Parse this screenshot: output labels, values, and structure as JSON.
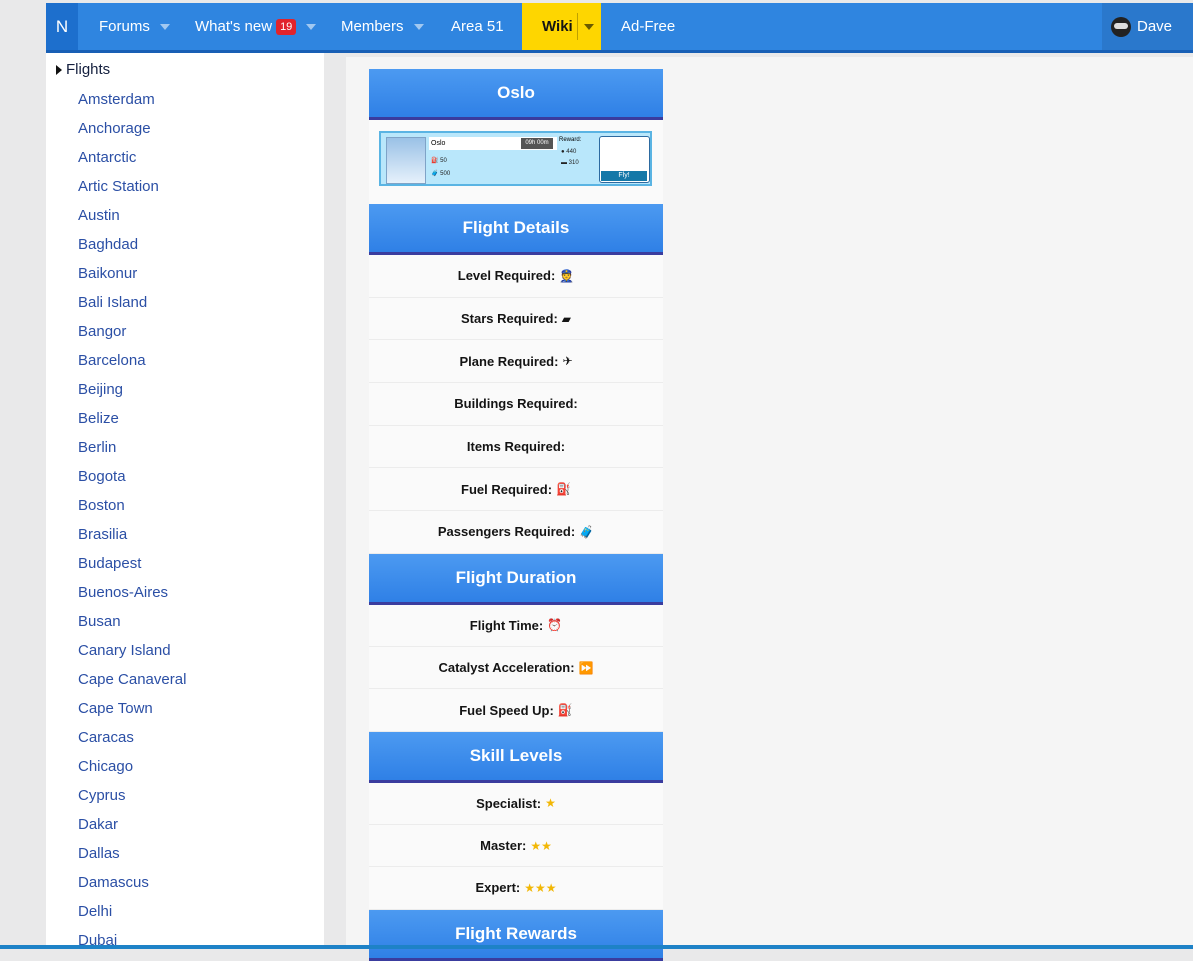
{
  "nav": {
    "logo": "N",
    "forums": "Forums",
    "whats_new": "What's new",
    "whats_new_badge": "19",
    "members": "Members",
    "area51": "Area 51",
    "wiki": "Wiki",
    "adfree": "Ad-Free",
    "user": "Dave"
  },
  "sidebar": {
    "section": "Flights",
    "items": [
      "Amsterdam",
      "Anchorage",
      "Antarctic",
      "Artic Station",
      "Austin",
      "Baghdad",
      "Baikonur",
      "Bali Island",
      "Bangor",
      "Barcelona",
      "Beijing",
      "Belize",
      "Berlin",
      "Bogota",
      "Boston",
      "Brasilia",
      "Budapest",
      "Buenos-Aires",
      "Busan",
      "Canary Island",
      "Cape Canaveral",
      "Cape Town",
      "Caracas",
      "Chicago",
      "Cyprus",
      "Dakar",
      "Dallas",
      "Damascus",
      "Delhi",
      "Dubai"
    ]
  },
  "infobox": {
    "title": "Oslo",
    "card": {
      "city": "Oslo",
      "time": "09h 00m",
      "fuel": "50",
      "passengers": "500",
      "reward_label": "Reward:",
      "reward_coins": "440",
      "reward_xp": "310",
      "fly": "Fly!"
    },
    "details_header": "Flight Details",
    "details": [
      {
        "label": "Level Required:",
        "icon": "👮"
      },
      {
        "label": "Stars Required:",
        "icon": "▰"
      },
      {
        "label": "Plane Required:",
        "icon": "✈"
      },
      {
        "label": "Buildings Required:",
        "icon": ""
      },
      {
        "label": "Items Required:",
        "icon": ""
      },
      {
        "label": "Fuel Required:",
        "icon": "⛽"
      },
      {
        "label": "Passengers Required:",
        "icon": "🧳"
      }
    ],
    "duration_header": "Flight Duration",
    "duration": [
      {
        "label": "Flight Time:",
        "icon": "⏰"
      },
      {
        "label": "Catalyst Acceleration:",
        "icon": "⏩"
      },
      {
        "label": "Fuel Speed Up:",
        "icon": "⛽"
      }
    ],
    "skills_header": "Skill Levels",
    "skills": [
      {
        "label": "Specialist:",
        "icon": "★"
      },
      {
        "label": "Master:",
        "icon": "★★"
      },
      {
        "label": "Expert:",
        "icon": "★★★"
      }
    ],
    "rewards_header": "Flight Rewards"
  },
  "colors": {
    "nav": "#2f85e0",
    "wiki_tab": "#fed600",
    "header_gradient_top": "#4c9af1",
    "header_gradient_bottom": "#2f80e6",
    "link": "#2b4fa5",
    "star": "#f2b705"
  }
}
